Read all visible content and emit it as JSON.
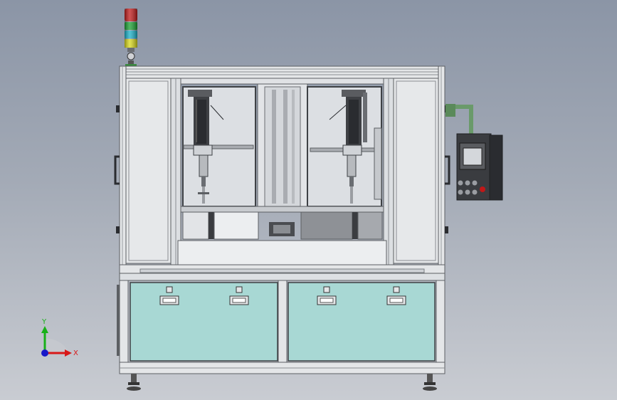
{
  "view": {
    "background_top": "#8b95a6",
    "background_bottom": "#c9ccd2"
  },
  "machine": {
    "frame_color": "#e4e6e8",
    "frame_edge_color": "#5c5f63",
    "drawer_panel_color": "#a8d8d4",
    "cabinet_color": "#3a3c40",
    "window_glass_color": "#dcdfe3",
    "stack_light_colors": [
      "#c01818",
      "#18a030",
      "#18b0c8",
      "#d8d818"
    ]
  },
  "triad": {
    "x_label": "X",
    "y_label": "Y",
    "x_color": "#d81818",
    "y_color": "#18b018",
    "z_color": "#1818c8"
  }
}
